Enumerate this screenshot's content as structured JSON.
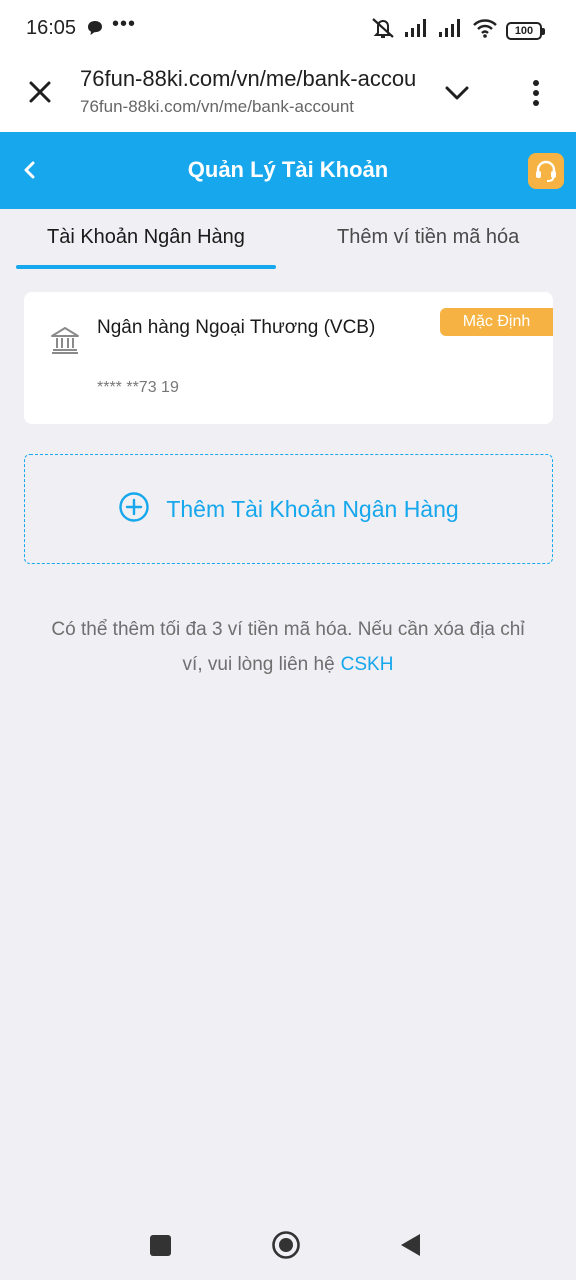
{
  "status_bar": {
    "time": "16:05",
    "more": "•••",
    "battery": "100",
    "icons": [
      "chat-bubble-icon",
      "mute-icon",
      "signal-icon",
      "signal-icon",
      "wifi-icon",
      "battery-icon"
    ]
  },
  "browser": {
    "title": "76fun-88ki.com/vn/me/bank-account",
    "url": "76fun-88ki.com/vn/me/bank-account",
    "icons": [
      "close-icon",
      "chevron-down-icon",
      "more-vertical-icon"
    ]
  },
  "header": {
    "title": "Quản Lý Tài Khoản",
    "icons": [
      "chevron-left-icon",
      "headset-icon"
    ],
    "accent_color": "#16a7ec",
    "support_color": "#f6b343"
  },
  "tabs": [
    {
      "label": "Tài Khoản Ngân Hàng",
      "active": true
    },
    {
      "label": "Thêm ví tiền mã hóa",
      "active": false
    }
  ],
  "bank_card": {
    "name": "Ngân hàng Ngoại Thương (VCB)",
    "account_number": "**** **73 19",
    "badge": "Mặc Định",
    "icon": "bank-icon"
  },
  "add_bank": {
    "label": "Thêm Tài Khoản Ngân Hàng",
    "icon": "plus-circle-icon"
  },
  "note": {
    "text": "Có thể thêm tối đa 3 ví tiền mã hóa. Nếu cần xóa địa chỉ ví, vui lòng liên hệ",
    "link": "CSKH"
  },
  "nav_bar": {
    "icons": [
      "recent-apps-icon",
      "home-icon",
      "back-icon"
    ]
  }
}
